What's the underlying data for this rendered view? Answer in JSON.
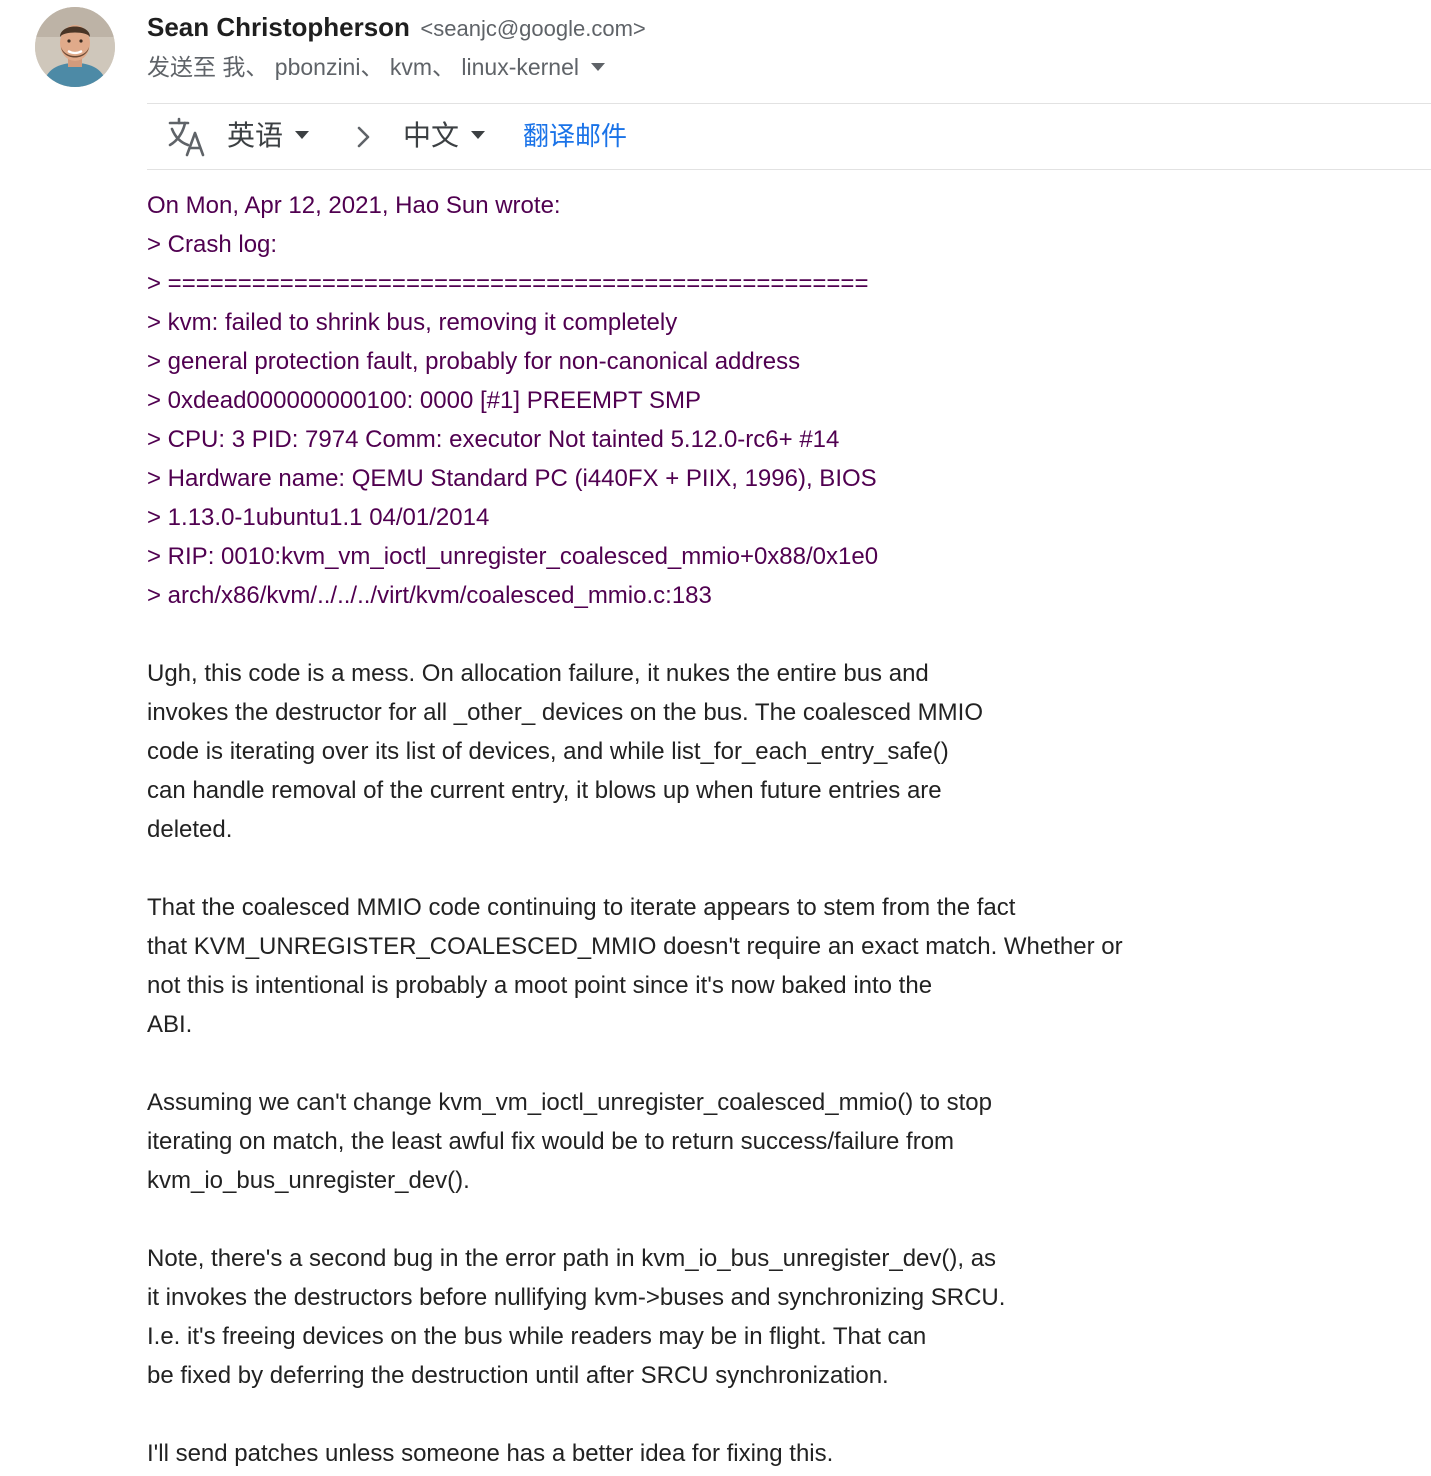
{
  "header": {
    "sender_name": "Sean Christopherson",
    "sender_email": "<seanjc@google.com>",
    "recipients": "发送至 我、 pbonzini、 kvm、 linux-kernel",
    "expand_icon": "chevron-down-icon",
    "avatar_icon": "person-avatar"
  },
  "translate": {
    "icon": "translate-icon",
    "source_lang": "英语",
    "arrow_icon": "chevron-right-icon",
    "target_lang": "中文",
    "action_label": "翻译邮件",
    "link_color": "#1a73e8"
  },
  "body": {
    "quote_color": "#500050",
    "quote_lines": [
      "On Mon, Apr 12, 2021, Hao Sun wrote:",
      "> Crash log:",
      "> ==================================================",
      "> kvm: failed to shrink bus, removing it completely",
      "> general protection fault, probably for non-canonical address",
      "> 0xdead000000000100: 0000 [#1] PREEMPT SMP",
      "> CPU: 3 PID: 7974 Comm: executor Not tainted 5.12.0-rc6+ #14",
      "> Hardware name: QEMU Standard PC (i440FX + PIIX, 1996), BIOS",
      "> 1.13.0-1ubuntu1.1 04/01/2014",
      "> RIP: 0010:kvm_vm_ioctl_unregister_coalesced_mmio+0x88/0x1e0",
      "> arch/x86/kvm/../../../virt/kvm/coalesced_mmio.c:183"
    ],
    "paragraphs": [
      [
        "Ugh, this code is a mess.  On allocation failure, it nukes the entire bus and",
        "invokes the destructor for all _other_ devices on the bus.  The coalesced MMIO",
        "code is iterating over its list of devices, and while list_for_each_entry_safe()",
        "can handle removal of the current entry, it blows up when future entries are",
        "deleted."
      ],
      [
        "That the coalesced MMIO code continuing to iterate appears to stem from the fact",
        "that KVM_UNREGISTER_COALESCED_MMIO doesn't require an exact match.  Whether or",
        "not this is intentional is probably a moot point since it's now baked into the",
        "ABI."
      ],
      [
        "Assuming we can't change kvm_vm_ioctl_unregister_coalesced_mmio() to stop",
        "iterating on match, the least awful fix would be to return success/failure from",
        "kvm_io_bus_unregister_dev()."
      ],
      [
        "Note, there's a second bug in the error path in kvm_io_bus_unregister_dev(), as",
        "it invokes the destructors before nullifying kvm->buses and synchronizing SRCU.",
        "I.e. it's freeing devices on the bus while readers may be in flight.  That can",
        "be fixed by deferring the destruction until after SRCU synchronization."
      ],
      [
        "I'll send patches unless someone has a better idea for fixing this."
      ]
    ]
  }
}
